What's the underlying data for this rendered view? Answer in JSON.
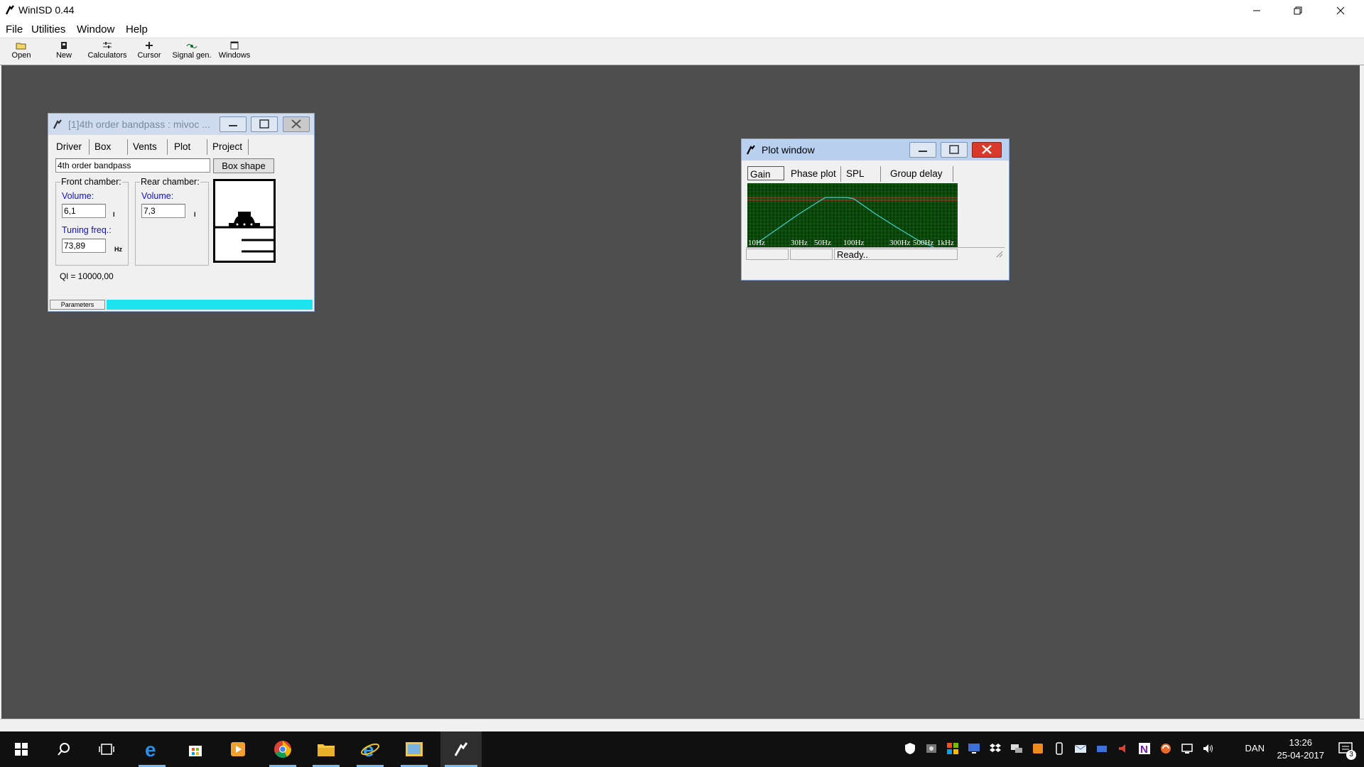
{
  "app": {
    "title": "WinISD 0.44"
  },
  "menu": [
    "File",
    "Utilities",
    "Window",
    "Help"
  ],
  "toolbar": [
    {
      "label": "Open",
      "icon": "folder-open-icon"
    },
    {
      "label": "New",
      "icon": "new-document-icon"
    },
    {
      "label": "Calculators",
      "icon": "calculator-sliders-icon"
    },
    {
      "label": "Cursor",
      "icon": "cursor-crosshair-icon"
    },
    {
      "label": "Signal gen.",
      "icon": "signal-generator-icon"
    },
    {
      "label": "Windows",
      "icon": "windows-icon"
    }
  ],
  "project_window": {
    "title": "[1]4th order bandpass : mivoc ...",
    "tabs": [
      "Driver",
      "Box",
      "Vents",
      "Plot",
      "Project"
    ],
    "active_tab": "Box",
    "box_type_value": "4th order bandpass",
    "box_shape_button": "Box shape",
    "front": {
      "label": "Front chamber:",
      "volume_label": "Volume:",
      "volume_value": "6,1",
      "volume_unit": "l",
      "tuning_label": "Tuning freq.:",
      "tuning_value": "73,89",
      "tuning_unit": "Hz"
    },
    "rear": {
      "label": "Rear chamber:",
      "volume_label": "Volume:",
      "volume_value": "7,3",
      "volume_unit": "l"
    },
    "ql_text": "Ql = 10000,00",
    "bottom_tab": "Parameters"
  },
  "plot_window": {
    "title": "Plot window",
    "tabs": [
      "Gain",
      "Phase plot",
      "SPL",
      "Group delay"
    ],
    "active_tab": "Gain",
    "x_labels": [
      "10Hz",
      "30Hz",
      "50Hz",
      "100Hz",
      "300Hz",
      "500Hz",
      "1kHz"
    ],
    "status": "Ready..",
    "curve_color": "#3fd0d0",
    "background_color": "#073b07"
  },
  "taskbar": {
    "apps": [
      "start-icon",
      "search-icon",
      "task-view-icon",
      "edge-icon",
      "store-icon",
      "media-player-icon",
      "chrome-icon",
      "file-explorer-icon",
      "internet-explorer-icon",
      "image-viewer-icon",
      "winisd-icon"
    ],
    "language": "DAN",
    "time": "13:26",
    "date": "25-04-2017",
    "notifications": "3"
  }
}
